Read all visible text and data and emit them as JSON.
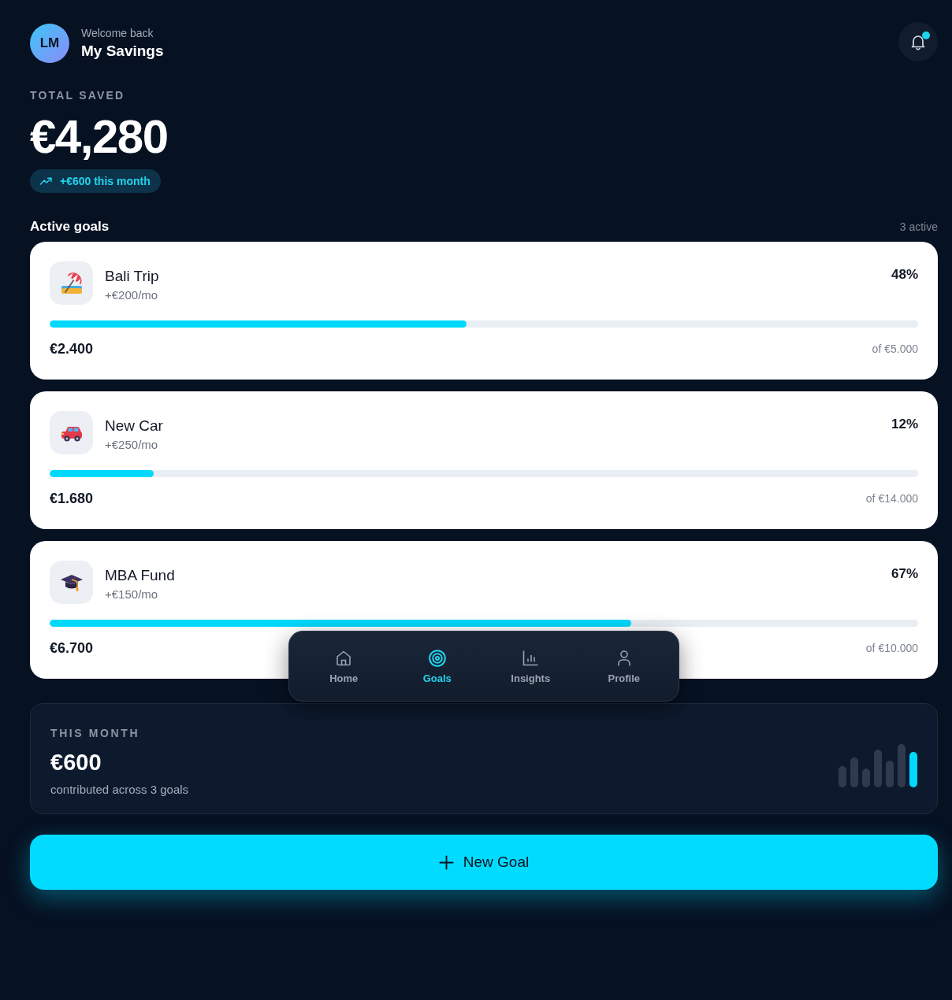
{
  "header": {
    "avatar_initials": "LM",
    "greeting": "Welcome back",
    "title": "My Savings",
    "notifications": {
      "unread": true
    }
  },
  "summary": {
    "label": "TOTAL SAVED",
    "amount": "€4,280",
    "change": "+€600 this month"
  },
  "goals_section": {
    "title": "Active goals",
    "count": "3 active"
  },
  "goals": [
    {
      "kind": "beach",
      "name": "Bali Trip",
      "rate": "+€200/mo",
      "percent": "48%",
      "level": 0.48,
      "saved": "€2.400",
      "target": "of €5.000"
    },
    {
      "kind": "car",
      "name": "New Car",
      "rate": "+€250/mo",
      "percent": "12%",
      "level": 0.12,
      "saved": "€1.680",
      "target": "of €14.000"
    },
    {
      "kind": "education",
      "name": "MBA Fund",
      "rate": "+€150/mo",
      "percent": "67%",
      "level": 0.67,
      "saved": "€6.700",
      "target": "of €10.000"
    }
  ],
  "this_month": {
    "label": "THIS MONTH",
    "amount": "€600",
    "caption": "contributed across 3 goals"
  },
  "new_goal_button": {
    "label": "New Goal"
  },
  "bottom_nav": [
    {
      "kind": "home",
      "label": "Home",
      "selected": false
    },
    {
      "kind": "goals",
      "label": "Goals",
      "selected": true
    },
    {
      "kind": "insights",
      "label": "Insights",
      "selected": false
    },
    {
      "kind": "profile",
      "label": "Profile",
      "selected": false
    }
  ]
}
